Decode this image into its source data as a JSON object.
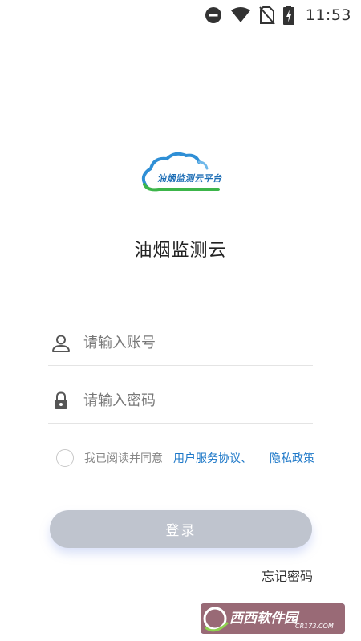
{
  "status_bar": {
    "time": "11:53",
    "icons": [
      "do-not-disturb-icon",
      "wifi-icon",
      "no-sim-icon",
      "battery-charging-icon"
    ]
  },
  "logo": {
    "text": "油烟监测云平台",
    "icon": "cloud-logo-icon"
  },
  "app_title": "油烟监测云",
  "form": {
    "account_placeholder": "请输入账号",
    "password_placeholder": "请输入密码",
    "account_icon": "user-icon",
    "password_icon": "lock-icon"
  },
  "agreement": {
    "prefix": "我已阅读并同意",
    "user_agreement": "用户服务协议",
    "separator": "、",
    "privacy_policy": "隐私政策",
    "checked": false
  },
  "login_button": "登录",
  "forgot_password": "忘记密码",
  "watermark": {
    "text": "西西软件园",
    "sub": "CR173.COM"
  },
  "colors": {
    "link": "#1e78c8",
    "button_disabled": "#bfc4ce",
    "logo_blue": "#1c6db5",
    "logo_green": "#3cb54a"
  }
}
